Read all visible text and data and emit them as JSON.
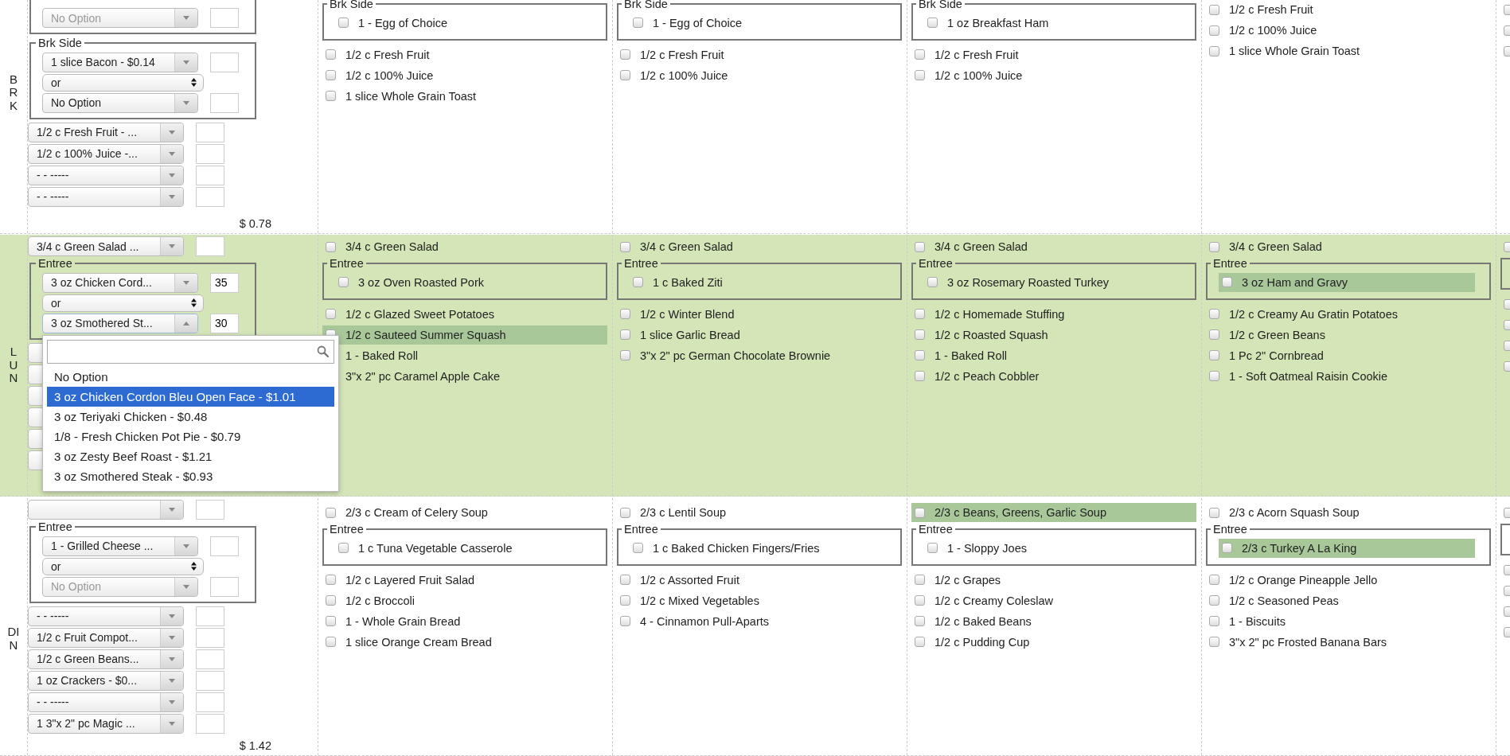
{
  "meals": [
    {
      "label": "BRK",
      "shaded": false,
      "total": "$ 0.78",
      "editor": [
        {
          "kind": "group",
          "entries": [
            {
              "kind": "select",
              "placeholder": "No Option",
              "open": false
            }
          ]
        },
        {
          "kind": "group",
          "legend": "Brk Side",
          "entries": [
            {
              "kind": "select",
              "value": "1 slice Bacon - $0.14",
              "open": false
            },
            {
              "kind": "connector",
              "value": "or"
            },
            {
              "kind": "select",
              "value": "No Option",
              "open": false
            }
          ]
        },
        {
          "kind": "select",
          "value": "1/2 c Fresh Fruit - ...",
          "open": false
        },
        {
          "kind": "select",
          "value": "1/2 c 100% Juice -...",
          "open": false
        },
        {
          "kind": "select",
          "value": "- - -----",
          "open": false
        },
        {
          "kind": "select",
          "value": "- - -----",
          "open": false
        }
      ],
      "days": [
        {
          "items": [
            {
              "kind": "group",
              "legend": "Brk Side",
              "items": [
                {
                  "kind": "check",
                  "label": "1 - Egg of Choice",
                  "checked": false,
                  "highlighted": false
                }
              ]
            },
            {
              "kind": "check",
              "label": "1/2 c Fresh Fruit",
              "checked": false,
              "highlighted": false
            },
            {
              "kind": "check",
              "label": "1/2 c 100% Juice",
              "checked": false,
              "highlighted": false
            },
            {
              "kind": "check",
              "label": "1 slice Whole Grain Toast",
              "checked": false,
              "highlighted": false
            }
          ]
        },
        {
          "items": [
            {
              "kind": "group",
              "legend": "Brk Side",
              "items": [
                {
                  "kind": "check",
                  "label": "1 - Egg of Choice",
                  "checked": false,
                  "highlighted": false
                }
              ]
            },
            {
              "kind": "check",
              "label": "1/2 c Fresh Fruit",
              "checked": false,
              "highlighted": false
            },
            {
              "kind": "check",
              "label": "1/2 c 100% Juice",
              "checked": false,
              "highlighted": false
            }
          ]
        },
        {
          "items": [
            {
              "kind": "group",
              "legend": "Brk Side",
              "items": [
                {
                  "kind": "check",
                  "label": "1 oz Breakfast Ham",
                  "checked": false,
                  "highlighted": false
                }
              ]
            },
            {
              "kind": "check",
              "label": "1/2 c Fresh Fruit",
              "checked": false,
              "highlighted": false
            },
            {
              "kind": "check",
              "label": "1/2 c 100% Juice",
              "checked": false,
              "highlighted": false
            }
          ]
        },
        {
          "items": [
            {
              "kind": "check",
              "label": "1/2 c Fresh Fruit",
              "checked": false,
              "highlighted": false
            },
            {
              "kind": "check",
              "label": "1/2 c 100% Juice",
              "checked": false,
              "highlighted": false
            },
            {
              "kind": "check",
              "label": "1 slice Whole Grain Toast",
              "checked": false,
              "highlighted": false
            }
          ]
        },
        {
          "items": [
            {
              "kind": "check",
              "checked": false,
              "highlighted": false
            },
            {
              "kind": "check",
              "checked": false,
              "highlighted": false
            },
            {
              "kind": "check",
              "checked": false,
              "highlighted": false
            }
          ]
        }
      ]
    },
    {
      "label": "LUN",
      "shaded": true,
      "editor": [
        {
          "kind": "select",
          "value": "3/4 c Green Salad ...",
          "open": false
        },
        {
          "kind": "group",
          "legend": "Entree",
          "entries": [
            {
              "kind": "select",
              "value": "3 oz Chicken Cord...",
              "qty": "35",
              "open": false
            },
            {
              "kind": "connector",
              "value": "or"
            },
            {
              "kind": "select",
              "value": "3 oz Smothered St...",
              "qty": "30",
              "open": true,
              "options": [
                {
                  "label": "No Option",
                  "selected": false
                },
                {
                  "label": "3 oz Chicken Cordon Bleu Open Face - $1.01",
                  "selected": true
                },
                {
                  "label": "3 oz Teriyaki Chicken - $0.48",
                  "selected": false
                },
                {
                  "label": "1/8 - Fresh Chicken Pot Pie - $0.79",
                  "selected": false
                },
                {
                  "label": "3 oz Zesty Beef Roast - $1.21",
                  "selected": false
                },
                {
                  "label": "3 oz Smothered Steak - $0.93",
                  "selected": false
                }
              ]
            }
          ]
        },
        {
          "kind": "select",
          "open": false
        },
        {
          "kind": "select",
          "open": false
        },
        {
          "kind": "select",
          "open": false
        },
        {
          "kind": "select",
          "open": false
        },
        {
          "kind": "select",
          "open": false
        },
        {
          "kind": "select",
          "open": false
        }
      ],
      "days": [
        {
          "items": [
            {
              "kind": "check",
              "label": "3/4 c Green Salad",
              "checked": false,
              "highlighted": false
            },
            {
              "kind": "group",
              "legend": "Entree",
              "items": [
                {
                  "kind": "check",
                  "label": "3 oz Oven Roasted Pork",
                  "checked": false,
                  "highlighted": false
                }
              ]
            },
            {
              "kind": "check",
              "label": "1/2 c Glazed Sweet Potatoes",
              "checked": false,
              "highlighted": false
            },
            {
              "kind": "check",
              "label": "1/2 c Sauteed Summer Squash",
              "checked": false,
              "highlighted": true
            },
            {
              "kind": "check",
              "label": "1 - Baked Roll",
              "highlighted": false
            },
            {
              "kind": "check",
              "label": "3\"x 2\" pc Caramel Apple Cake",
              "highlighted": false
            }
          ]
        },
        {
          "items": [
            {
              "kind": "check",
              "label": "3/4 c Green Salad",
              "checked": false,
              "highlighted": false
            },
            {
              "kind": "group",
              "legend": "Entree",
              "items": [
                {
                  "kind": "check",
                  "label": "1 c Baked Ziti",
                  "checked": false,
                  "highlighted": false
                }
              ]
            },
            {
              "kind": "check",
              "label": "1/2 c Winter Blend",
              "checked": false,
              "highlighted": false
            },
            {
              "kind": "check",
              "label": "1 slice Garlic Bread",
              "checked": false,
              "highlighted": false
            },
            {
              "kind": "check",
              "label": "3\"x 2\" pc German Chocolate Brownie",
              "checked": false,
              "highlighted": false
            }
          ]
        },
        {
          "items": [
            {
              "kind": "check",
              "label": "3/4 c Green Salad",
              "checked": false,
              "highlighted": false
            },
            {
              "kind": "group",
              "legend": "Entree",
              "items": [
                {
                  "kind": "check",
                  "label": "3 oz Rosemary Roasted Turkey",
                  "checked": false,
                  "highlighted": false
                }
              ]
            },
            {
              "kind": "check",
              "label": "1/2 c Homemade Stuffing",
              "checked": false,
              "highlighted": false
            },
            {
              "kind": "check",
              "label": "1/2 c Roasted Squash",
              "checked": false,
              "highlighted": false
            },
            {
              "kind": "check",
              "label": "1 - Baked Roll",
              "checked": false,
              "highlighted": false
            },
            {
              "kind": "check",
              "label": "1/2 c Peach Cobbler",
              "checked": false,
              "highlighted": false
            }
          ]
        },
        {
          "items": [
            {
              "kind": "check",
              "label": "3/4 c Green Salad",
              "checked": false,
              "highlighted": false
            },
            {
              "kind": "group",
              "legend": "Entree",
              "items": [
                {
                  "kind": "check",
                  "label": "3 oz Ham and Gravy",
                  "checked": false,
                  "highlighted": true
                }
              ]
            },
            {
              "kind": "check",
              "label": "1/2 c Creamy Au Gratin Potatoes",
              "checked": false,
              "highlighted": false
            },
            {
              "kind": "check",
              "label": "1/2 c Green Beans",
              "checked": false,
              "highlighted": false
            },
            {
              "kind": "check",
              "label": "1 Pc 2\" Cornbread",
              "checked": false,
              "highlighted": false
            },
            {
              "kind": "check",
              "label": "1 - Soft Oatmeal Raisin Cookie",
              "checked": false,
              "highlighted": false
            }
          ]
        },
        {
          "items": [
            {
              "kind": "check",
              "checked": false,
              "highlighted": false
            },
            {
              "kind": "group"
            },
            {
              "kind": "check",
              "checked": false,
              "highlighted": false
            },
            {
              "kind": "check",
              "checked": false,
              "highlighted": false
            },
            {
              "kind": "check",
              "checked": false,
              "highlighted": false
            },
            {
              "kind": "check",
              "checked": false,
              "highlighted": false
            }
          ]
        }
      ]
    },
    {
      "label": "DIN",
      "shaded": false,
      "total": "$ 1.42",
      "editor": [
        {
          "kind": "select",
          "open": false
        },
        {
          "kind": "group",
          "legend": "Entree",
          "entries": [
            {
              "kind": "select",
              "value": "1 - Grilled Cheese ...",
              "open": false
            },
            {
              "kind": "connector",
              "value": "or"
            },
            {
              "kind": "select",
              "placeholder": "No Option",
              "open": false
            }
          ]
        },
        {
          "kind": "select",
          "value": "- - -----",
          "open": false
        },
        {
          "kind": "select",
          "value": "1/2 c Fruit Compot...",
          "open": false
        },
        {
          "kind": "select",
          "value": "1/2 c Green Beans...",
          "open": false
        },
        {
          "kind": "select",
          "value": "1 oz Crackers - $0...",
          "open": false
        },
        {
          "kind": "select",
          "value": "- - -----",
          "open": false
        },
        {
          "kind": "select",
          "value": "1 3\"x 2\" pc Magic ...",
          "open": false
        }
      ],
      "days": [
        {
          "items": [
            {
              "kind": "check",
              "label": "2/3 c Cream of Celery Soup",
              "checked": false,
              "highlighted": false
            },
            {
              "kind": "group",
              "legend": "Entree",
              "items": [
                {
                  "kind": "check",
                  "label": "1 c Tuna Vegetable Casserole",
                  "checked": false,
                  "highlighted": false
                }
              ]
            },
            {
              "kind": "check",
              "label": "1/2 c Layered Fruit Salad",
              "checked": false,
              "highlighted": false
            },
            {
              "kind": "check",
              "label": "1/2 c Broccoli",
              "checked": false,
              "highlighted": false
            },
            {
              "kind": "check",
              "label": "1 - Whole Grain Bread",
              "checked": false,
              "highlighted": false
            },
            {
              "kind": "check",
              "label": "1 slice Orange Cream Bread",
              "checked": false,
              "highlighted": false
            }
          ]
        },
        {
          "items": [
            {
              "kind": "check",
              "label": "2/3 c Lentil Soup",
              "checked": false,
              "highlighted": false
            },
            {
              "kind": "group",
              "legend": "Entree",
              "items": [
                {
                  "kind": "check",
                  "label": "1 c Baked Chicken Fingers/Fries",
                  "checked": false,
                  "highlighted": false
                }
              ]
            },
            {
              "kind": "check",
              "label": "1/2 c Assorted Fruit",
              "checked": false,
              "highlighted": false
            },
            {
              "kind": "check",
              "label": "1/2 c Mixed Vegetables",
              "checked": false,
              "highlighted": false
            },
            {
              "kind": "check",
              "label": "4 - Cinnamon Pull-Aparts",
              "checked": false,
              "highlighted": false
            }
          ]
        },
        {
          "items": [
            {
              "kind": "check",
              "label": "2/3 c Beans, Greens, Garlic Soup",
              "checked": false,
              "highlighted": true
            },
            {
              "kind": "group",
              "legend": "Entree",
              "items": [
                {
                  "kind": "check",
                  "label": "1 - Sloppy Joes",
                  "checked": false,
                  "highlighted": false
                }
              ]
            },
            {
              "kind": "check",
              "label": "1/2 c Grapes",
              "checked": false,
              "highlighted": false
            },
            {
              "kind": "check",
              "label": "1/2 c Creamy Coleslaw",
              "checked": false,
              "highlighted": false
            },
            {
              "kind": "check",
              "label": "1/2 c Baked Beans",
              "checked": false,
              "highlighted": false
            },
            {
              "kind": "check",
              "label": "1/2 c Pudding Cup",
              "checked": false,
              "highlighted": false
            }
          ]
        },
        {
          "items": [
            {
              "kind": "check",
              "label": "2/3 c Acorn Squash Soup",
              "checked": false,
              "highlighted": false
            },
            {
              "kind": "group",
              "legend": "Entree",
              "items": [
                {
                  "kind": "check",
                  "label": "2/3 c Turkey A La King",
                  "checked": false,
                  "highlighted": true
                }
              ]
            },
            {
              "kind": "check",
              "label": "1/2 c Orange Pineapple Jello",
              "checked": false,
              "highlighted": false
            },
            {
              "kind": "check",
              "label": "1/2 c Seasoned Peas",
              "checked": false,
              "highlighted": false
            },
            {
              "kind": "check",
              "label": "1 - Biscuits",
              "checked": false,
              "highlighted": false
            },
            {
              "kind": "check",
              "label": "3\"x 2\" pc Frosted Banana Bars",
              "checked": false,
              "highlighted": false
            }
          ]
        },
        {
          "items": [
            {
              "kind": "check",
              "checked": false,
              "highlighted": false
            },
            {
              "kind": "group"
            },
            {
              "kind": "check",
              "checked": false,
              "highlighted": false
            },
            {
              "kind": "check",
              "checked": false,
              "highlighted": false
            },
            {
              "kind": "check",
              "checked": false,
              "highlighted": false
            },
            {
              "kind": "check",
              "checked": false,
              "highlighted": false
            }
          ]
        }
      ]
    }
  ]
}
